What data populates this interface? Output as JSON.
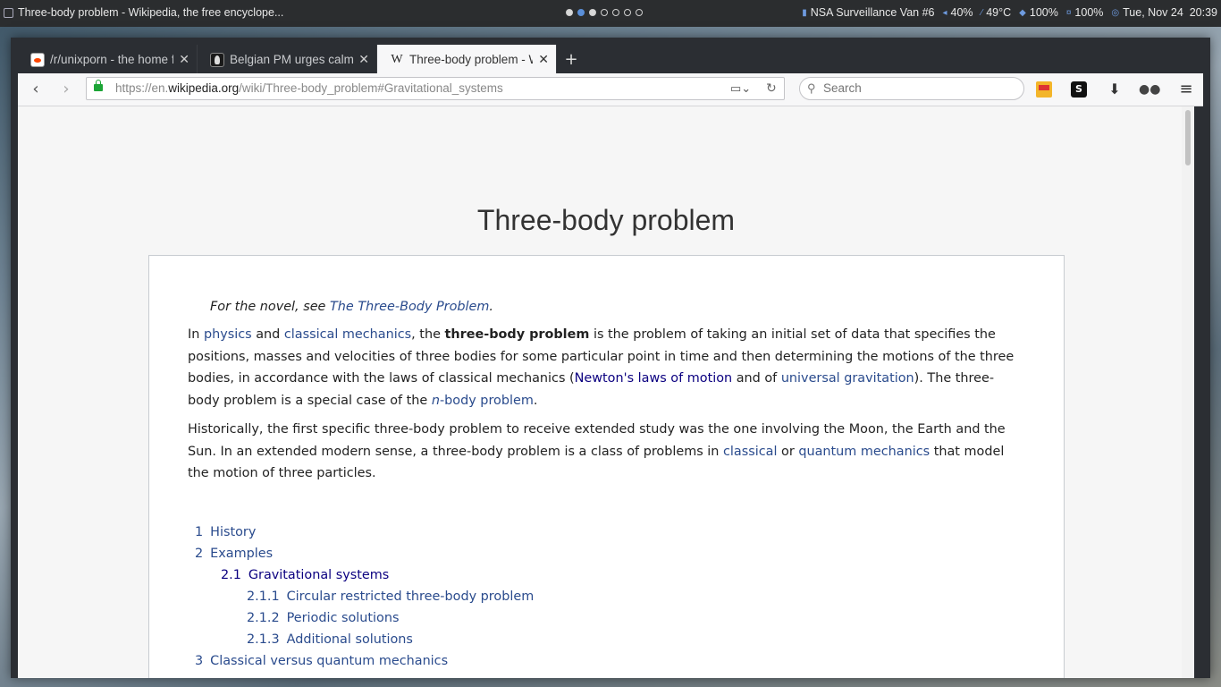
{
  "system_bar": {
    "window_title": "Three-body problem - Wikipedia, the free encyclope...",
    "workspaces": [
      "filled",
      "active",
      "filled",
      "empty",
      "empty",
      "empty",
      "empty"
    ],
    "network": "NSA Surveillance Van #6",
    "volume": "40%",
    "temperature": "49°C",
    "brightness": "100%",
    "battery": "100%",
    "datetime": "Tue, Nov 24  20:39"
  },
  "tabs": [
    {
      "label": "/r/unixporn - the home f...",
      "favicon": "reddit-icon"
    },
    {
      "label": "Belgian PM urges calm, ...",
      "favicon": "news-icon"
    },
    {
      "label": "Three-body problem - Wi...",
      "favicon": "wikipedia-icon",
      "active": true
    }
  ],
  "navbar": {
    "url_prefix": "https://en.",
    "url_domain": "wikipedia.org",
    "url_path": "/wiki/Three-body_problem#Gravitational_systems",
    "search_placeholder": "Search"
  },
  "article": {
    "title": "Three-body problem",
    "hatnote_prefix": "For the novel, see ",
    "hatnote_link": "The Three-Body Problem",
    "hatnote_suffix": ".",
    "p1": {
      "t1": "In ",
      "l_physics": "physics",
      "t2": " and ",
      "l_classical_mechanics": "classical mechanics",
      "t3": ", the ",
      "bold": "three-body problem",
      "t4": " is the problem of taking an initial set of data that specifies the positions, masses and velocities of three bodies for some particular point in time and then determining the motions of the three bodies, in accordance with the laws of classical mechanics (",
      "l_newton": "Newton's laws of motion",
      "t5": " and of ",
      "l_gravitation": "universal gravitation",
      "t6": "). The three-body problem is a special case of the ",
      "l_nbody_n": "n",
      "l_nbody_rest": "-body problem",
      "t7": "."
    },
    "p2": {
      "t1": "Historically, the first specific three-body problem to receive extended study was the one involving the Moon, the Earth and the Sun. In an extended modern sense, a three-body problem is a class of problems in ",
      "l_classical": "classical",
      "t2": " or ",
      "l_quantum": "quantum mechanics",
      "t3": " that model the motion of three particles."
    },
    "toc": [
      {
        "num": "1",
        "label": "History",
        "level": 1
      },
      {
        "num": "2",
        "label": "Examples",
        "level": 1
      },
      {
        "num": "2.1",
        "label": "Gravitational systems",
        "level": 2,
        "visited": true
      },
      {
        "num": "2.1.1",
        "label": "Circular restricted three-body problem",
        "level": 3
      },
      {
        "num": "2.1.2",
        "label": "Periodic solutions",
        "level": 3
      },
      {
        "num": "2.1.3",
        "label": "Additional solutions",
        "level": 3
      },
      {
        "num": "3",
        "label": "Classical versus quantum mechanics",
        "level": 1
      }
    ]
  }
}
